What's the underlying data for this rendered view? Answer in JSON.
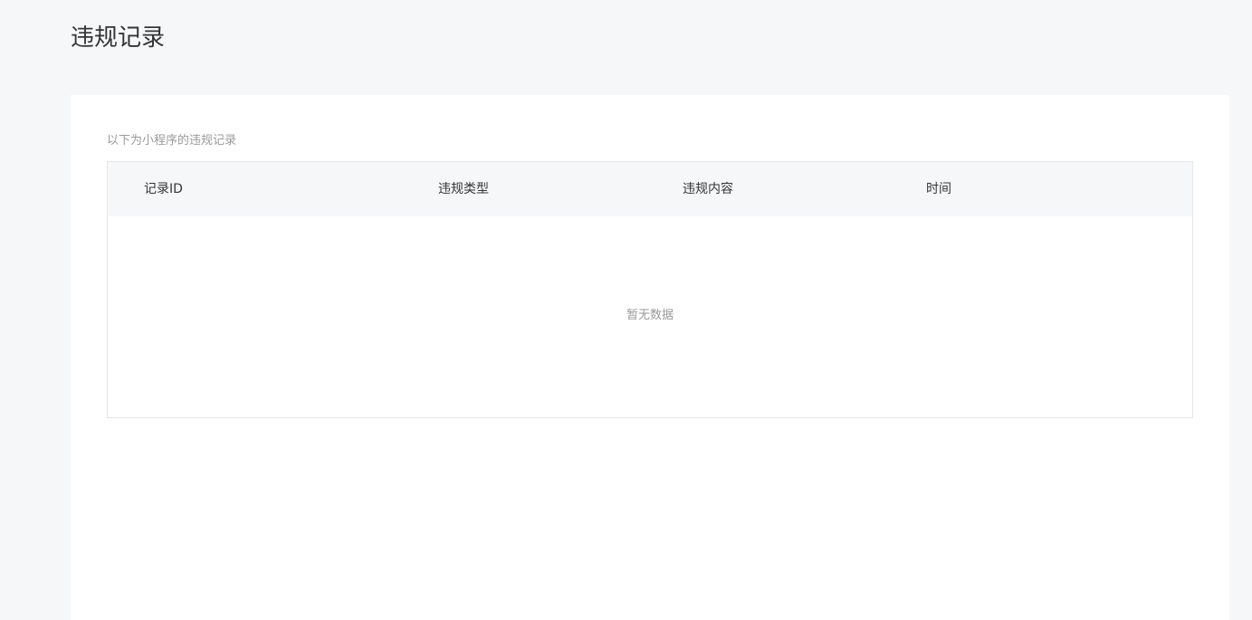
{
  "page": {
    "title": "违规记录"
  },
  "card": {
    "description": "以下为小程序的违规记录"
  },
  "table": {
    "columns": [
      "记录ID",
      "违规类型",
      "违规内容",
      "时间"
    ],
    "rows": [],
    "empty_text": "暂无数据"
  },
  "colors": {
    "page_background": "#f6f7f9",
    "card_background": "#ffffff",
    "header_background": "#f6f7f9",
    "border": "#e6e6e6",
    "muted_text": "#9a9a9a",
    "primary_text": "#353535"
  }
}
